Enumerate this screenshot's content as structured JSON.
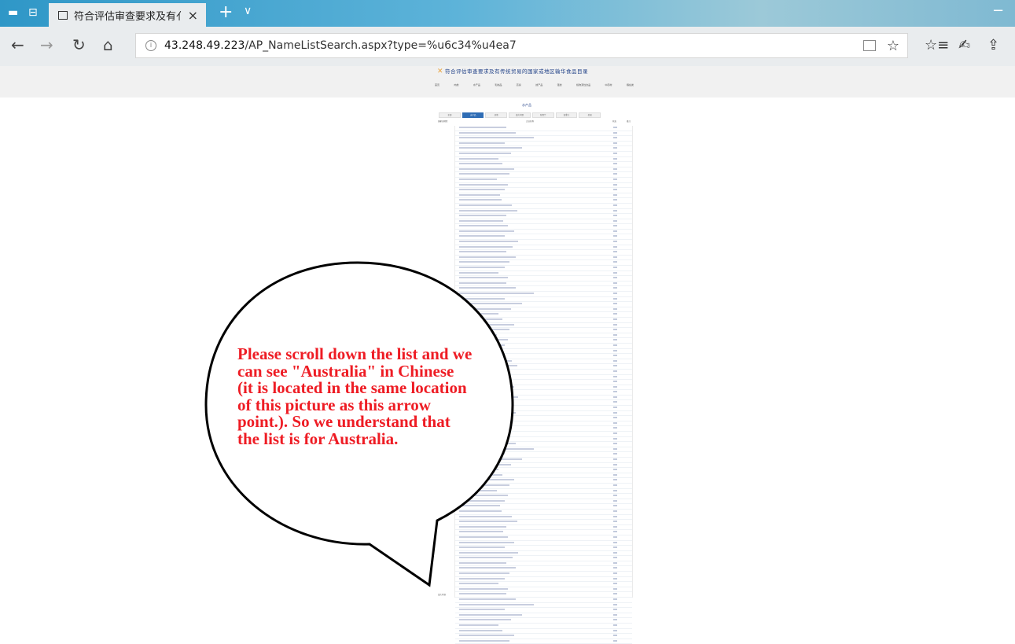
{
  "browser": {
    "tab_title": "符合评估审查要求及有亻",
    "tab_close": "×",
    "new_tab": "+",
    "tab_menu": "∨",
    "minimize": "−",
    "url_host": "43.248.49.223",
    "url_path": "/AP_NameListSearch.aspx?type=%u6c34%u4ea7",
    "info_glyph": "i",
    "back": "←",
    "forward": "→",
    "refresh": "↻",
    "home": "⌂",
    "favorite": "☆",
    "favorites_hub": "☆≡",
    "notes": "✍",
    "share": "⇪"
  },
  "site": {
    "title": "符合评估审查要求及有传统贸易的国家或地区输华食品目录",
    "menu": [
      "首页",
      "肉类",
      "水产品",
      "乳制品",
      "燕窝",
      "蜂产品",
      "蛋类",
      "植物源性食品",
      "中药材",
      "粮谷类"
    ],
    "table_title": "水产品",
    "filters": [
      "全部",
      "水产品",
      "其他",
      "澳大利亚",
      "新西兰",
      "加拿大",
      "美国"
    ],
    "col_country": "国家或地区",
    "col_name": "企业名称",
    "col_status": "状态",
    "col_note": "备注",
    "row_label": "澳大利亚"
  },
  "annotation": {
    "text": "Please scroll down the list and we can see \"Australia\" in Chinese (it is located in the same location of this picture as this arrow point.). So we understand that the list is for Australia."
  },
  "colors": {
    "tabbar_start": "#2f97c7",
    "accent_blue": "#1e3f86",
    "annotation_red": "#ee1c24"
  }
}
